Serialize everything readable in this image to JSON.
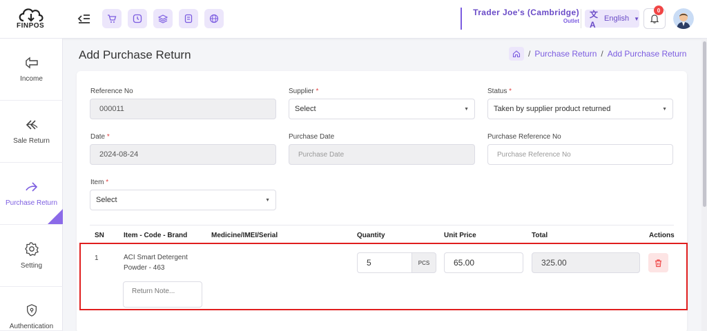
{
  "app": {
    "logo_text": "FINPOS"
  },
  "header": {
    "outlet_name": "Trader Joe's (Cambridge)",
    "outlet_type": "Outlet",
    "language": "English",
    "notification_count": "0",
    "quick_icons": [
      "cart-icon",
      "clock-icon",
      "layers-icon",
      "receipt-icon",
      "globe-icon"
    ]
  },
  "sidebar": {
    "items": [
      {
        "label": "Income",
        "icon": "income-icon"
      },
      {
        "label": "Sale Return",
        "icon": "sale-return-icon"
      },
      {
        "label": "Purchase Return",
        "icon": "purchase-return-icon",
        "active": true
      },
      {
        "label": "Setting",
        "icon": "gear-icon"
      },
      {
        "label": "Authentication",
        "icon": "shield-icon"
      }
    ]
  },
  "page": {
    "title": "Add Purchase Return",
    "breadcrumb": [
      "Purchase Return",
      "Add Purchase Return"
    ]
  },
  "form": {
    "reference_no": {
      "label": "Reference No",
      "value": "000011"
    },
    "supplier": {
      "label": "Supplier",
      "value": "Select"
    },
    "status": {
      "label": "Status",
      "value": "Taken by supplier product returned"
    },
    "date": {
      "label": "Date",
      "value": "2024-08-24"
    },
    "purchase_date": {
      "label": "Purchase Date",
      "placeholder": "Purchase Date"
    },
    "purchase_reference_no": {
      "label": "Purchase Reference No",
      "placeholder": "Purchase Reference No"
    },
    "item": {
      "label": "Item",
      "value": "Select"
    },
    "required_mark": "*"
  },
  "table": {
    "headers": {
      "sn": "SN",
      "item": "Item - Code - Brand",
      "serial": "Medicine/IMEI/Serial",
      "quantity": "Quantity",
      "unit_price": "Unit Price",
      "total": "Total",
      "actions": "Actions"
    },
    "rows": [
      {
        "sn": "1",
        "item_line1": "ACI Smart Detergent",
        "item_line2": "Powder - 463",
        "quantity": "5",
        "unit": "PCS",
        "unit_price": "65.00",
        "total": "325.00",
        "note_placeholder": "Return Note..."
      }
    ]
  },
  "colors": {
    "accent": "#7b5ce0",
    "highlight_border": "#e01e1e",
    "danger": "#f04545"
  }
}
